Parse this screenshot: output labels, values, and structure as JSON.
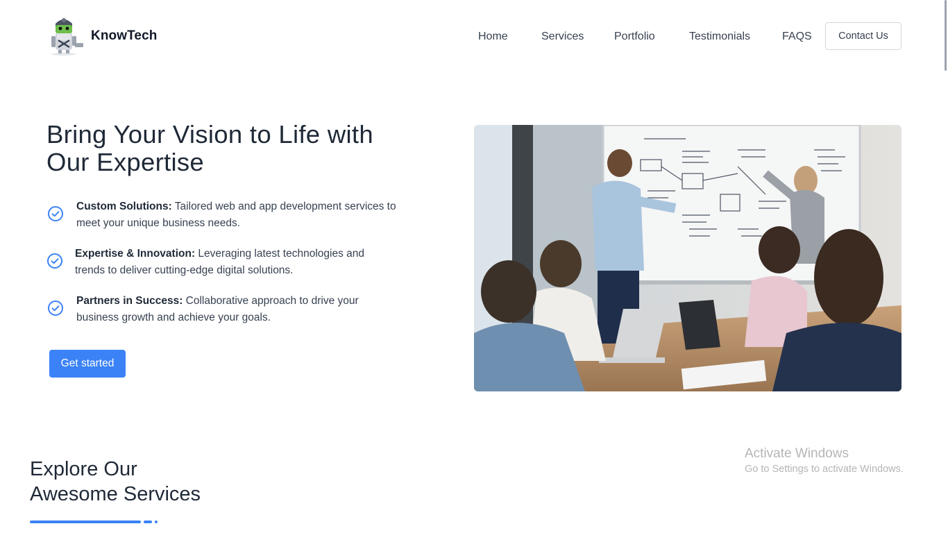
{
  "brand": {
    "name": "KnowTech",
    "logo_icon": "robot-mascot-icon"
  },
  "nav": {
    "links": [
      "Home",
      "Services",
      "Portfolio",
      "Testimonials",
      "FAQS"
    ],
    "contact_label": "Contact Us"
  },
  "hero": {
    "title_line1": "Bring Your Vision to Life with",
    "title_line2": "Our Expertise",
    "features": [
      {
        "title": "Custom Solutions:",
        "line1": " Tailored web and app development services to",
        "line2": "meet your unique business needs."
      },
      {
        "title": "Expertise & Innovation:",
        "line1": " Leveraging latest technologies and",
        "line2": "trends to deliver cutting-edge digital solutions."
      },
      {
        "title": "Partners in Success:",
        "line1": " Collaborative approach to drive your",
        "line2": "business growth and achieve your goals."
      }
    ],
    "cta_label": "Get started",
    "image_icon": "team-meeting-whiteboard-photo"
  },
  "services": {
    "title_line1": "Explore Our",
    "title_line2": "Awesome Services"
  },
  "watermark": {
    "title": "Activate Windows",
    "subtitle": "Go to Settings to activate Windows."
  },
  "colors": {
    "accent": "#3b82f6",
    "text_dark": "#1f2937",
    "text_body": "#374151",
    "watermark": "#b5b5b5"
  }
}
